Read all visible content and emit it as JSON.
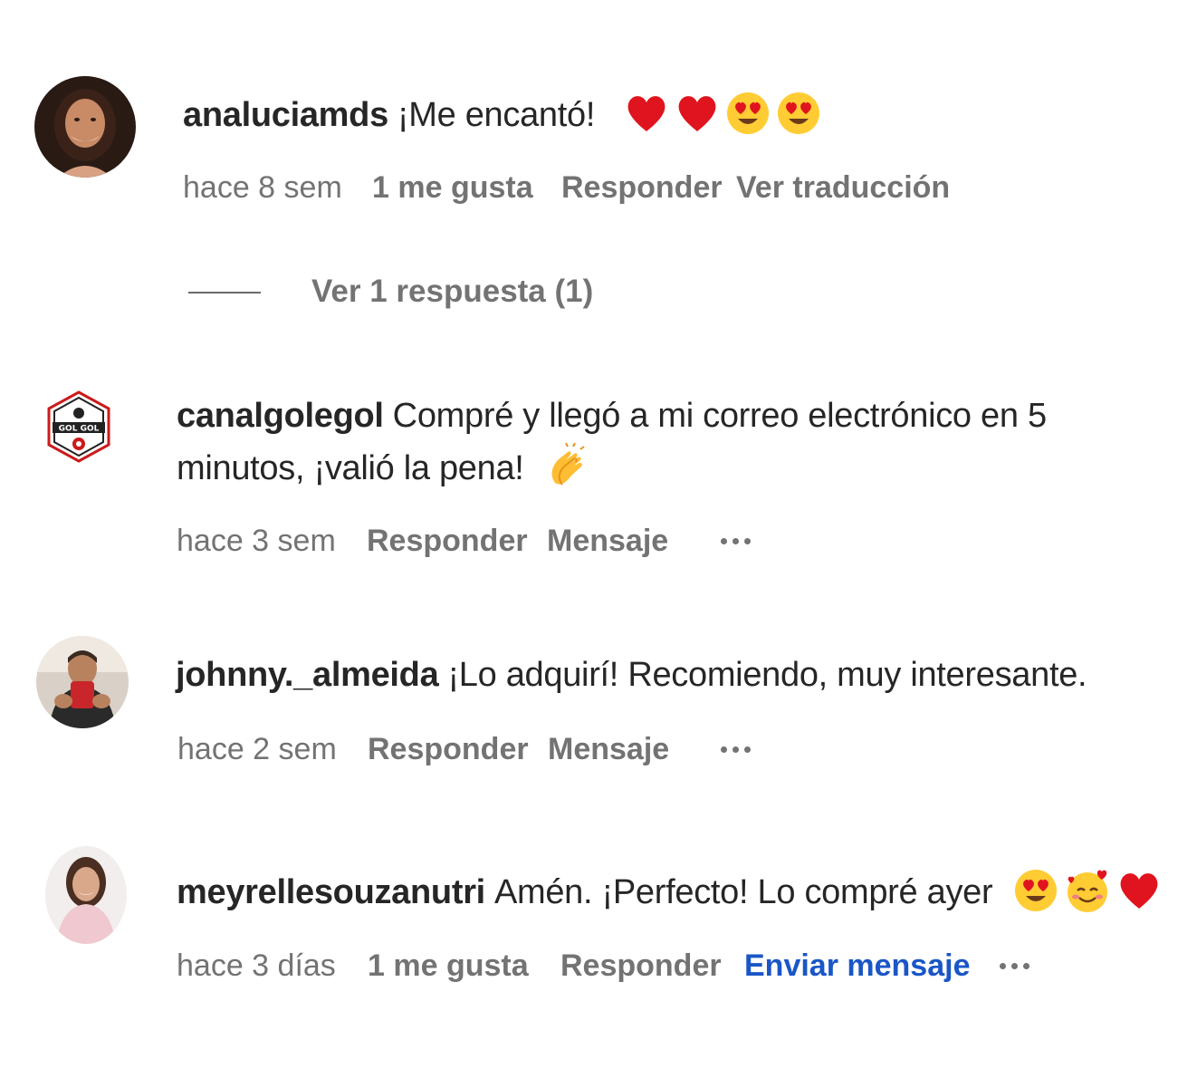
{
  "comments": [
    {
      "username": "analuciamds",
      "text": "¡Me encantó!",
      "emojis": [
        "red-heart",
        "red-heart",
        "heart-eyes",
        "heart-eyes"
      ],
      "time": "hace 8 sem",
      "likes": "1 me gusta",
      "reply": "Responder",
      "translate": "Ver traducción"
    },
    {
      "username": "canalgolegol",
      "text": "Compré y llegó a mi correo electrónico en 5 minutos, ¡valió la pena!",
      "emojis": [
        "clapping-hands"
      ],
      "avatar_label": "GOL GOL",
      "time": "hace 3 sem",
      "reply": "Responder",
      "message": "Mensaje"
    },
    {
      "username": "johnny._almeida",
      "text": "¡Lo adquirí! Recomiendo, muy interesante.",
      "time": "hace 2 sem",
      "reply": "Responder",
      "message": "Mensaje"
    },
    {
      "username": "meyrellesouzanutri",
      "text": "Amén. ¡Perfecto! Lo compré ayer",
      "emojis": [
        "heart-eyes",
        "smiling-face-with-hearts",
        "red-heart"
      ],
      "time": "hace 3 días",
      "likes": "1 me gusta",
      "reply": "Responder",
      "send_message": "Enviar mensaje"
    }
  ],
  "replies_toggle": "Ver 1 respuesta (1)",
  "colors": {
    "text": "#262626",
    "meta": "#737373",
    "link_blue": "#1a56c7",
    "heart": "#e0141e",
    "emoji_yellow": "#ffcc33"
  }
}
